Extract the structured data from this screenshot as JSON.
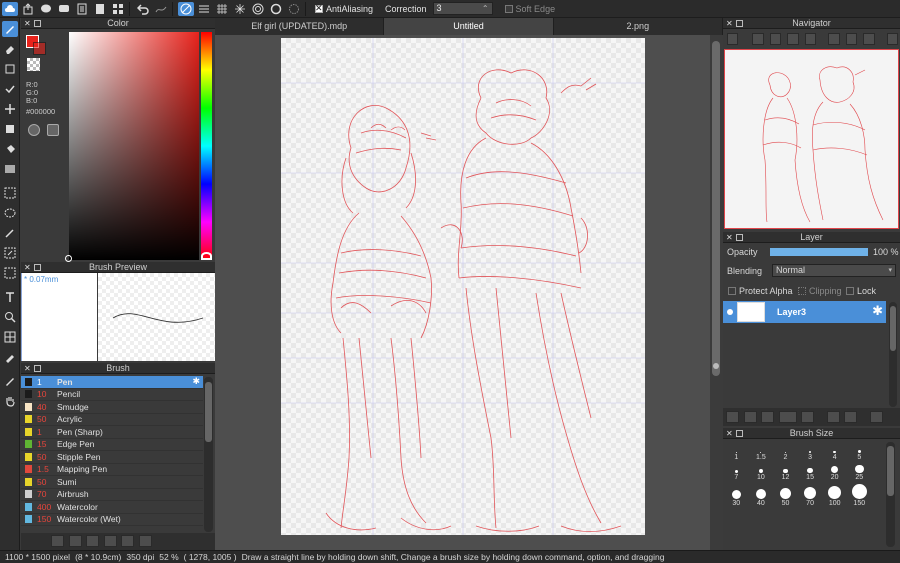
{
  "toolbar": {
    "antialias_label": "AntiAliasing",
    "correction_label": "Correction",
    "correction_value": "3",
    "soft_edge_label": "Soft Edge"
  },
  "tabs": [
    {
      "label": "Elf girl (UPDATED).mdp"
    },
    {
      "label": "Untitled"
    },
    {
      "label": "2.png"
    }
  ],
  "color_panel": {
    "title": "Color",
    "r": "R:0",
    "g": "G:0",
    "b": "B:0",
    "hex": "#000000",
    "primary_color": "#e8231c",
    "secondary_color": "#ffffff"
  },
  "brush_preview": {
    "title": "Brush Preview",
    "size": "* 0.07mm"
  },
  "brush_panel": {
    "title": "Brush",
    "items": [
      {
        "size": "1",
        "name": "Pen",
        "color": "#1b1b1b"
      },
      {
        "size": "10",
        "name": "Pencil",
        "color": "#1b1b1b"
      },
      {
        "size": "40",
        "name": "Smudge",
        "color": "#f7e4c4"
      },
      {
        "size": "50",
        "name": "Acrylic",
        "color": "#e8d52a"
      },
      {
        "size": "1",
        "name": "Pen (Sharp)",
        "color": "#e8d52a"
      },
      {
        "size": "15",
        "name": "Edge Pen",
        "color": "#5fb533"
      },
      {
        "size": "50",
        "name": "Stipple Pen",
        "color": "#e8d52a"
      },
      {
        "size": "1.5",
        "name": "Mapping Pen",
        "color": "#e0483c"
      },
      {
        "size": "50",
        "name": "Sumi",
        "color": "#e8d52a"
      },
      {
        "size": "70",
        "name": "Airbrush",
        "color": "#cfcfcf"
      },
      {
        "size": "400",
        "name": "Watercolor",
        "color": "#62b8e0"
      },
      {
        "size": "150",
        "name": "Watercolor (Wet)",
        "color": "#62b8e0"
      }
    ]
  },
  "navigator": {
    "title": "Navigator"
  },
  "layer_panel": {
    "title": "Layer",
    "opacity_label": "Opacity",
    "opacity_value": "100 %",
    "opacity_fraction": 1.0,
    "blending_label": "Blending",
    "blending_value": "Normal",
    "protect_alpha_label": "Protect Alpha",
    "clipping_label": "Clipping",
    "lock_label": "Lock",
    "layers": [
      {
        "name": "Layer3"
      }
    ]
  },
  "brush_size_panel": {
    "title": "Brush Size",
    "sizes": [
      "1",
      "1.5",
      "2",
      "3",
      "4",
      "5",
      "7",
      "10",
      "12",
      "15",
      "20",
      "25",
      "30",
      "40",
      "50",
      "70",
      "100",
      "150"
    ]
  },
  "status": {
    "pixels": "1100 * 1500 pixel",
    "cm": "(8 * 10.9cm)",
    "dpi": "350 dpi",
    "zoom": "52 %",
    "coords": "( 1278, 1005 )",
    "hint": "Draw a straight line by holding down shift, Change a brush size by holding down command, option, and dragging"
  }
}
